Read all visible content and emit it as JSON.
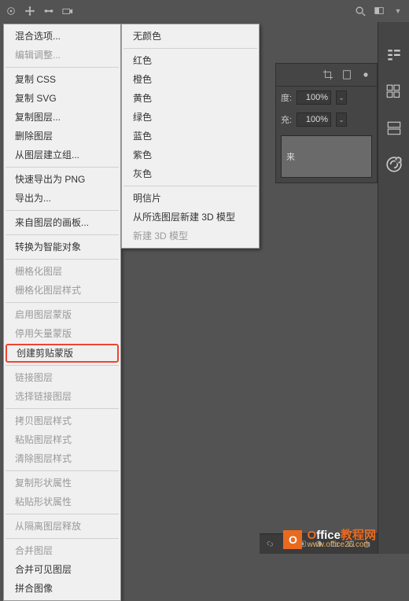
{
  "toolbar": {},
  "panel": {
    "opacity_label": "度:",
    "opacity_value": "100%",
    "fill_label": "充:",
    "fill_value": "100%",
    "layer_partial_text": "来"
  },
  "menu": {
    "items": [
      {
        "label": "混合选项...",
        "disabled": false
      },
      {
        "label": "编辑调整...",
        "disabled": true
      },
      {
        "sep": true
      },
      {
        "label": "复制 CSS",
        "disabled": false
      },
      {
        "label": "复制 SVG",
        "disabled": false
      },
      {
        "label": "复制图层...",
        "disabled": false
      },
      {
        "label": "删除图层",
        "disabled": false
      },
      {
        "label": "从图层建立组...",
        "disabled": false
      },
      {
        "sep": true
      },
      {
        "label": "快速导出为 PNG",
        "disabled": false
      },
      {
        "label": "导出为...",
        "disabled": false
      },
      {
        "sep": true
      },
      {
        "label": "来自图层的画板...",
        "disabled": false
      },
      {
        "sep": true
      },
      {
        "label": "转换为智能对象",
        "disabled": false
      },
      {
        "sep": true
      },
      {
        "label": "栅格化图层",
        "disabled": true
      },
      {
        "label": "栅格化图层样式",
        "disabled": true
      },
      {
        "sep": true
      },
      {
        "label": "启用图层蒙版",
        "disabled": true
      },
      {
        "label": "停用矢量蒙版",
        "disabled": true
      },
      {
        "label": "创建剪贴蒙版",
        "disabled": false,
        "highlight": true
      },
      {
        "sep": true
      },
      {
        "label": "链接图层",
        "disabled": true
      },
      {
        "label": "选择链接图层",
        "disabled": true
      },
      {
        "sep": true
      },
      {
        "label": "拷贝图层样式",
        "disabled": true
      },
      {
        "label": "粘贴图层样式",
        "disabled": true
      },
      {
        "label": "清除图层样式",
        "disabled": true
      },
      {
        "sep": true
      },
      {
        "label": "复制形状属性",
        "disabled": true
      },
      {
        "label": "粘贴形状属性",
        "disabled": true
      },
      {
        "sep": true
      },
      {
        "label": "从隔离图层释放",
        "disabled": true
      },
      {
        "sep": true
      },
      {
        "label": "合并图层",
        "disabled": true
      },
      {
        "label": "合并可见图层",
        "disabled": false
      },
      {
        "label": "拼合图像",
        "disabled": false
      }
    ]
  },
  "submenu": {
    "items": [
      {
        "label": "无颜色",
        "disabled": false
      },
      {
        "sep": true
      },
      {
        "label": "红色",
        "disabled": false
      },
      {
        "label": "橙色",
        "disabled": false
      },
      {
        "label": "黄色",
        "disabled": false
      },
      {
        "label": "绿色",
        "disabled": false
      },
      {
        "label": "蓝色",
        "disabled": false
      },
      {
        "label": "紫色",
        "disabled": false
      },
      {
        "label": "灰色",
        "disabled": false
      },
      {
        "sep": true
      },
      {
        "label": "明信片",
        "disabled": false
      },
      {
        "label": "从所选图层新建 3D 模型",
        "disabled": false
      },
      {
        "label": "新建 3D 模型",
        "disabled": true
      }
    ]
  },
  "watermark": {
    "brand_prefix": "O",
    "brand_suffix": "ffice",
    "brand_cn": "教程网",
    "url": "www.office26.com",
    "badge": "O"
  }
}
